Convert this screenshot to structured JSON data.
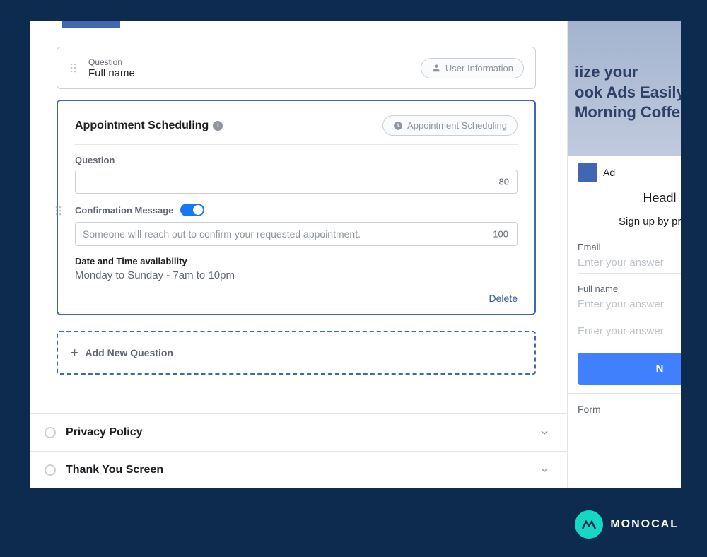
{
  "question_card": {
    "label": "Question",
    "value": "Full name",
    "pill": "User Information"
  },
  "appointment": {
    "title": "Appointment Scheduling",
    "pill": "Appointment Scheduling",
    "question_label": "Question",
    "question_count": "80",
    "confirm_label": "Confirmation Message",
    "confirm_placeholder": "Someone will reach out to confirm your requested appointment.",
    "confirm_count": "100",
    "avail_label": "Date and Time availability",
    "avail_value": "Monday to Sunday - 7am to 10pm",
    "delete": "Delete"
  },
  "add_question": "Add New Question",
  "sections": {
    "privacy": "Privacy Policy",
    "thankyou": "Thank You Screen"
  },
  "preview": {
    "banner_line1": "iize your",
    "banner_line2": "ook Ads Easily,",
    "banner_line3": "Morning Coffee",
    "ad_label": "Ad",
    "headline": "Headl",
    "signup": "Sign up by provid",
    "email_label": "Email",
    "email_placeholder": "Enter your answer",
    "fullname_label": "Full name",
    "fullname_placeholder": "Enter your answer",
    "extra_placeholder": "Enter your answer",
    "next": "N",
    "form_label": "Form"
  },
  "brand": "MONOCAL"
}
